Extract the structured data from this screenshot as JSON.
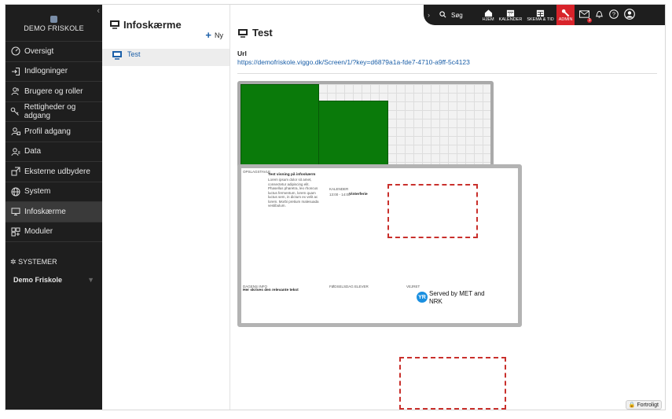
{
  "sidebar": {
    "school_name": "DEMO FRISKOLE",
    "items": [
      {
        "label": "Oversigt",
        "icon": "dashboard-icon"
      },
      {
        "label": "Indlogninger",
        "icon": "login-icon"
      },
      {
        "label": "Brugere og roller",
        "icon": "users-icon"
      },
      {
        "label": "Rettigheder og adgang",
        "icon": "key-icon"
      },
      {
        "label": "Profil adgang",
        "icon": "profile-icon"
      },
      {
        "label": "Data",
        "icon": "data-icon"
      },
      {
        "label": "Eksterne udbydere",
        "icon": "external-icon"
      },
      {
        "label": "System",
        "icon": "globe-icon"
      },
      {
        "label": "Infoskærme",
        "icon": "monitor-icon",
        "active": true
      },
      {
        "label": "Moduler",
        "icon": "modules-icon"
      }
    ],
    "systems_title": "SYSTEMER",
    "system_selected": "Demo Friskole"
  },
  "list": {
    "title": "Infoskærme",
    "new_label": "Ny",
    "items": [
      {
        "label": "Test"
      }
    ]
  },
  "topbar": {
    "search_label": "Søg",
    "nav": [
      {
        "label": "HJEM",
        "icon": "home-icon"
      },
      {
        "label": "KALENDER",
        "icon": "calendar-icon"
      },
      {
        "label": "SKEMA & TID",
        "icon": "schedule-icon"
      },
      {
        "label": "ADMIN",
        "icon": "wrench-icon",
        "active": true
      }
    ],
    "message_count": "3"
  },
  "main": {
    "title": "Test",
    "url_label": "Url",
    "url_value": "https://demofriskole.viggo.dk/Screen/1/?key=d6879a1a-fde7-4710-a9ff-5c4123"
  },
  "preview2": {
    "opslagstavle": "OPSLAGSTAVLE",
    "post_title": "Test visning på infoskærm",
    "post_text": "Lorem ipsum dolor sit amet, consectetur adipiscing elit. Phasellus pharetra, leo rhoncus luctus fermentum, lorem quam luctus sem, in dictum ex velit ac lorem. Morbi pretium malesuada vestibulum.",
    "kalender": "KALENDER",
    "kalender_time": "13:00 - 14:00",
    "kalender_event": "Vinterferie",
    "dagens_info": "DAGENS INFO",
    "dagens_info_text": "Her skrives den relevante tekst",
    "birthdays": "FØDSELSDAG ELEVER",
    "vejret": "VEJRET",
    "weather_credit": "Served by MET and NRK",
    "yr": "YR"
  },
  "footer": {
    "confidential": "Fortroligt"
  },
  "colors": {
    "sidebar_bg": "#1e1e1e",
    "accent_red": "#d8232a",
    "tile_green": "#0a7a0a",
    "link_blue": "#1b5fa8"
  }
}
